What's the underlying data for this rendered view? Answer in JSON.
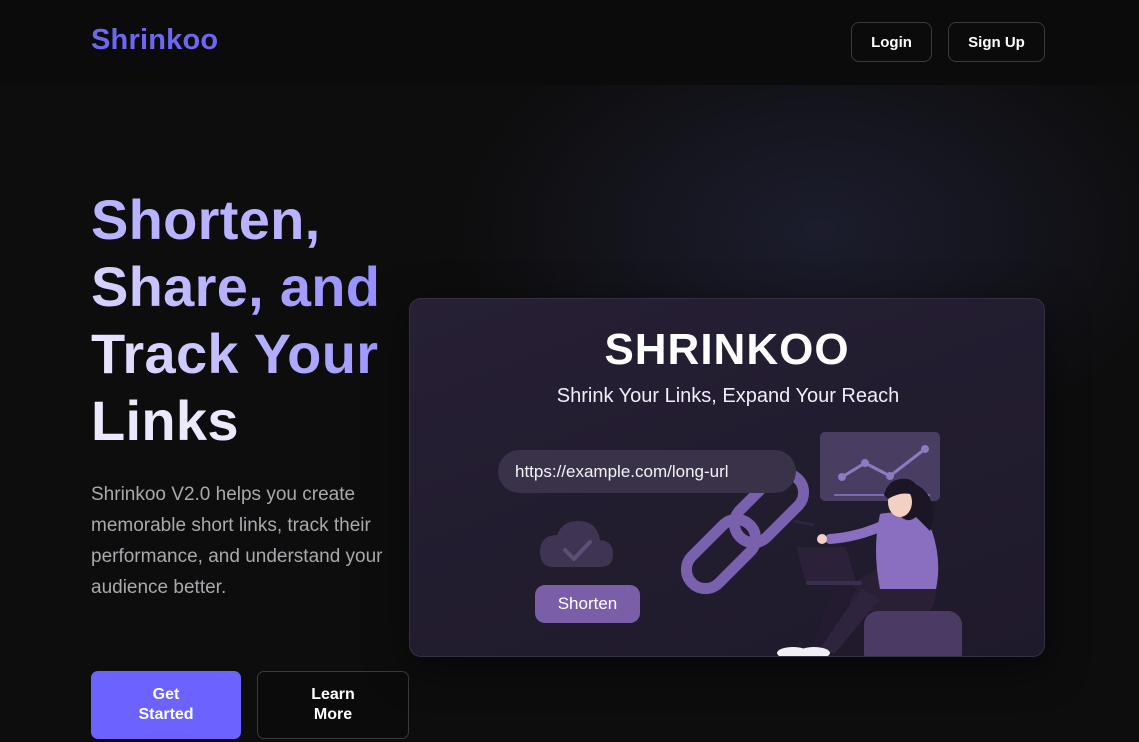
{
  "navbar": {
    "logo": "Shrinkoo",
    "login_label": "Login",
    "signup_label": "Sign Up"
  },
  "hero": {
    "title_lines": [
      "Shorten,",
      "Share, and",
      "Track Your",
      "Links"
    ],
    "description": "Shrinkoo V2.0 helps you create memorable short links, track their performance, and understand your audience better.",
    "get_started_label": "Get Started",
    "learn_more_label": "Learn More"
  },
  "preview_card": {
    "brand": "SHRINKOO",
    "tagline": "Shrink Your Links, Expand Your Reach",
    "url_value": "https://example.com/long-url",
    "shorten_label": "Shorten",
    "icons": [
      "cloud-check-icon",
      "chain-link-icon",
      "analytics-chart-icon",
      "person-with-laptop-illustration"
    ]
  },
  "colors": {
    "accent": "#6c63ff",
    "logo": "#6e67f2",
    "background": "#0d0d0e",
    "card": "#241d31",
    "card_purple": "#7a5fa8"
  }
}
